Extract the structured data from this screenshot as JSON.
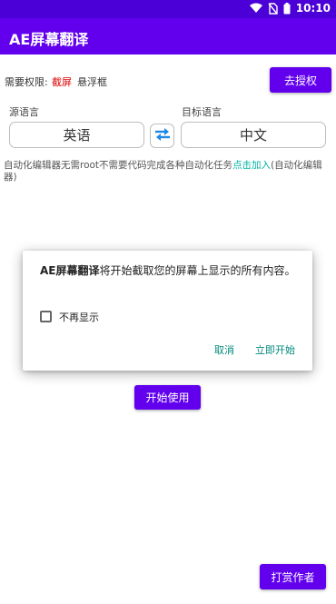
{
  "status_bar": {
    "time": "10:10",
    "icons": [
      "wifi-icon",
      "no-sim-icon",
      "battery-icon"
    ],
    "color": "#4a00d6"
  },
  "app_bar": {
    "title": "AE屏幕翻译",
    "color": "#6200ee"
  },
  "permissions": {
    "label": "需要权限:",
    "screen": "截屏",
    "float": "悬浮框",
    "screen_color": "#e00000"
  },
  "authorize_button": {
    "label": "去授权"
  },
  "language": {
    "source_label": "源语言",
    "target_label": "目标语言",
    "source_value": "英语",
    "target_value": "中文",
    "swap_icon": "swap-arrows-icon"
  },
  "info": {
    "text": "自动化编辑器无需root不需要代码完成各种自动化任务",
    "link": "点击加入",
    "suffix": "(自动化编辑器)",
    "link_color": "#00b3a4"
  },
  "dialog": {
    "app_name": "AE屏幕翻译",
    "message": "将开始截取您的屏幕上显示的所有内容。",
    "checkbox_label": "不再显示",
    "checkbox_checked": false,
    "cancel": "取消",
    "start_now": "立即开始",
    "button_color": "#00897b"
  },
  "start_use_button": {
    "label": "开始使用"
  },
  "reward_button": {
    "label": "打赏作者"
  }
}
